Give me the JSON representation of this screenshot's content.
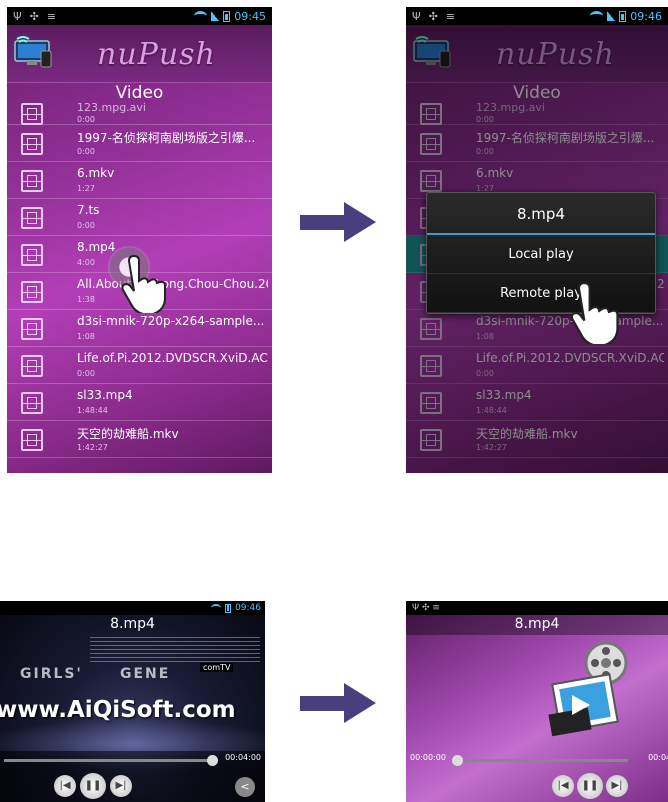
{
  "colors": {
    "screen_purple": "#9a35a0",
    "status_blue": "#4fc3f7",
    "highlight_teal": "#1f9aa0",
    "arrow_navy": "#4a3f7e"
  },
  "screen1": {
    "status": {
      "time": "09:45"
    },
    "header": {
      "brand": "nuPush"
    },
    "section_title": "Video",
    "items": [
      {
        "name": "123.mpg.avi",
        "duration": "0:00",
        "partial": true
      },
      {
        "name": "1997-名侦探柯南剧场版之引爆...",
        "duration": "0:00"
      },
      {
        "name": "6.mkv",
        "duration": "1:27"
      },
      {
        "name": "7.ts",
        "duration": "0:00"
      },
      {
        "name": "8.mp4",
        "duration": "4:00"
      },
      {
        "name": "All.About.Ah-Long.Chou-Chou.2001...",
        "duration": "1:38"
      },
      {
        "name": "d3si-mnik-720p-x264-sample...",
        "duration": "1:08"
      },
      {
        "name": "Life.of.Pi.2012.DVDSCR.XviD.AC...",
        "duration": "0:00"
      },
      {
        "name": "sl33.mp4",
        "duration": "1:48:44"
      },
      {
        "name": "天空的劫难船.mkv",
        "duration": "1:42:27"
      }
    ]
  },
  "screen2": {
    "status": {
      "time": "09:46"
    },
    "header": {
      "brand": "nuPush"
    },
    "section_title": "Video",
    "items": [
      {
        "name": "123.mpg.avi",
        "duration": "0:00",
        "partial": true
      },
      {
        "name": "1997-名侦探柯南剧场版之引爆...",
        "duration": "0:00"
      },
      {
        "name": "6.mkv",
        "duration": "1:27"
      },
      {
        "name": "7.ts",
        "duration": "0:00"
      },
      {
        "name": "8.mp4",
        "duration": "4:00",
        "highlight": true
      },
      {
        "name": "All.About.Ah-Long.Chou-Chou.2001...",
        "duration": "1:38"
      },
      {
        "name": "d3si-mnik-720p-x264-sample...",
        "duration": "1:08"
      },
      {
        "name": "Life.of.Pi.2012.DVDSCR.XviD.AC",
        "duration": "0:00"
      },
      {
        "name": "sl33.mp4",
        "duration": "1:48:44"
      },
      {
        "name": "天空的劫难船.mkv",
        "duration": "1:42:27"
      }
    ],
    "dialog": {
      "title": "8.mp4",
      "local_play": "Local play",
      "remote_play": "Remote play"
    }
  },
  "screen3": {
    "status": {
      "time": "09:46"
    },
    "title": "8.mp4",
    "stage_text_left": "GIRLS'",
    "stage_text_right": "GENE",
    "stage_badge": "comTV",
    "watermark": "www.AiQiSoft.com",
    "time_end": "00:04:00",
    "progress_fraction": 1.0
  },
  "screen4": {
    "title": "8.mp4",
    "time_start": "00:00:00",
    "time_end": "00:04:00",
    "progress_fraction": 0.0
  },
  "controls": {
    "prev_icon": "skip-previous-icon",
    "play_icon": "pause-icon",
    "next_icon": "skip-next-icon",
    "share_icon": "share-icon"
  }
}
